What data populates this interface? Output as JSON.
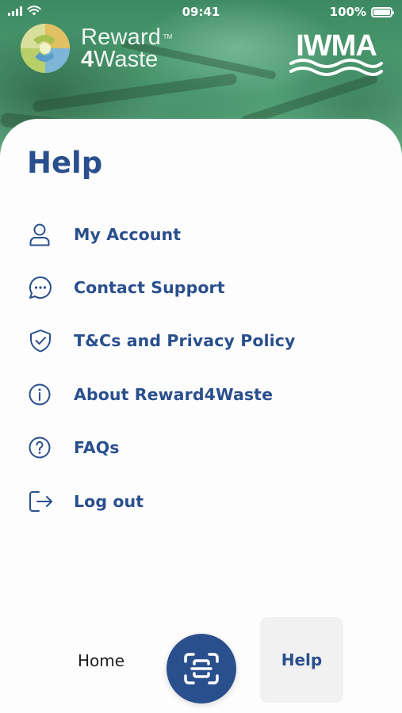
{
  "status_bar": {
    "time": "09:41",
    "battery_text": "100%",
    "battery_level": 1.0,
    "icons": [
      "signal-icon",
      "wifi-icon",
      "battery-icon"
    ]
  },
  "header": {
    "brand_line1": "Reward",
    "brand_line2_bold": "4",
    "brand_line2_rest": "Waste",
    "trademark": "TM",
    "partner_logo": "IWMA"
  },
  "page": {
    "title": "Help"
  },
  "menu": {
    "items": [
      {
        "label": "My Account",
        "icon": "user-icon"
      },
      {
        "label": "Contact Support",
        "icon": "chat-bubble-icon"
      },
      {
        "label": "T&Cs and Privacy Policy",
        "icon": "shield-check-icon"
      },
      {
        "label": "About Reward4Waste",
        "icon": "info-icon"
      },
      {
        "label": "FAQs",
        "icon": "question-icon"
      },
      {
        "label": "Log out",
        "icon": "logout-icon"
      }
    ]
  },
  "bottom_nav": {
    "home_label": "Home",
    "help_label": "Help",
    "scan_icon": "scan-icon",
    "active_tab": "Help"
  },
  "colors": {
    "primary": "#2a4f8d",
    "nav_active_bg": "#f1f1f1",
    "header_green": "#4f9d73"
  }
}
